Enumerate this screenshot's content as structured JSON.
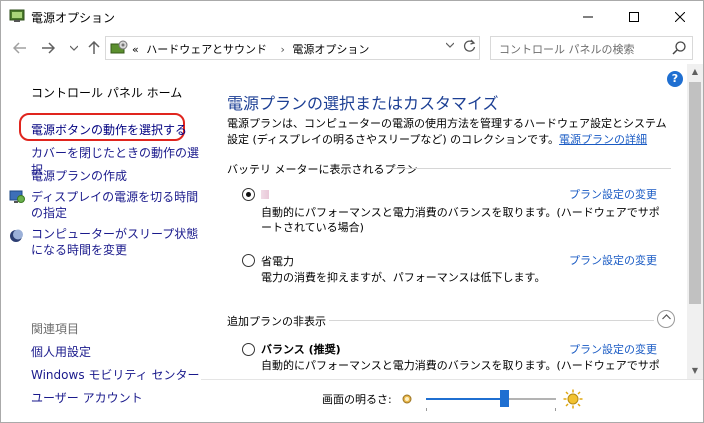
{
  "window": {
    "title": "電源オプション"
  },
  "addressbar": {
    "overflow": "«",
    "crumbs": [
      "ハードウェアとサウンド",
      "電源オプション"
    ]
  },
  "search": {
    "placeholder": "コントロール パネルの検索"
  },
  "leftpane": {
    "home": "コントロール パネル ホーム",
    "links": {
      "power_button": "電源ボタンの動作を選択する",
      "lid": "カバーを閉じたときの動作の選択",
      "create_plan": "電源プランの作成",
      "display_off": "ディスプレイの電源を切る時間の指定",
      "sleep": "コンピューターがスリープ状態になる時間を変更"
    },
    "related_heading": "関連項目",
    "related": {
      "personalization": "個人用設定",
      "mobility": "Windows モビリティ センター",
      "accounts": "ユーザー アカウント"
    }
  },
  "content": {
    "title": "電源プランの選択またはカスタマイズ",
    "description": "電源プランは、コンピューターの電源の使用方法を管理するハードウェア設定とシステム設定 (ディスプレイの明るさやスリープなど) のコレクションです。",
    "details_link": "電源プランの詳細",
    "battery_section": "バッテリ メーターに表示されるプラン",
    "hidden_section": "追加プランの非表示",
    "plans": [
      {
        "name": "",
        "link": "プラン設定の変更",
        "description": "自動的にパフォーマンスと電力消費のバランスを取ります。(ハードウェアでサポートされている場合)",
        "checked": true
      },
      {
        "name": "省電力",
        "link": "プラン設定の変更",
        "description": "電力の消費を抑えますが、パフォーマンスは低下します。",
        "checked": false
      },
      {
        "name": "バランス (推奨)",
        "link": "プラン設定の変更",
        "description": "自動的にパフォーマンスと電力消費のバランスを取ります。(ハードウェアでサポートされている場合)",
        "checked": false
      }
    ]
  },
  "brightness": {
    "label": "画面の明るさ:",
    "level_fraction": 0.6
  },
  "colors": {
    "link_blue": "#1a5bc4",
    "title_blue": "#1c3f94",
    "highlight_red": "#e0251e",
    "slider_blue": "#1f6fd1"
  },
  "icons": {
    "app": "power-options-icon",
    "help": "help-icon",
    "search": "search-icon",
    "refresh": "refresh-icon"
  }
}
